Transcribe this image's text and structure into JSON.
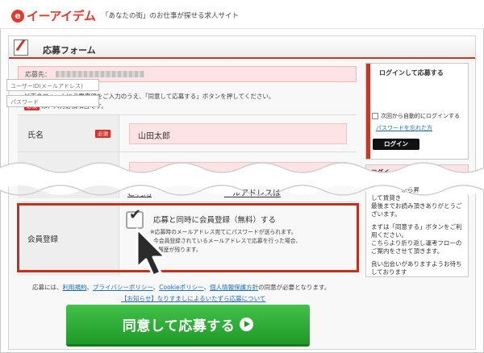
{
  "header": {
    "logo_mark": "e",
    "logo_text": "イーアイデム",
    "tagline": "「あなたの街」のお仕事が探せる求人サイト"
  },
  "form": {
    "title": "応募フォーム",
    "destination_label": "応募先：",
    "instruction_line1": "以下のフォームに必要事項をご入力のうえ、「同意して応募する」ボタンを押してください。",
    "required_badge": "必須",
    "instruction_line2": "は、入力必須項目です。",
    "name_label": "氏名",
    "name_value": "山田太郎",
    "terms_partial": "ご利用",
    "terms_partial_right": "ールアドレスは",
    "member_label": "会員登録",
    "register_label": "応募と同時に会員登録（無料）する",
    "register_checked": true,
    "register_note1": "※応募時のメールアドレス宛てにパスワードが送られます。",
    "register_note2": "今会員登録されているメールアドレスで応募を行った場合、",
    "register_note3": "履歴が残ります。"
  },
  "agreement": {
    "prefix": "応募には、",
    "terms": "利用規約",
    "privacy": "プライバシーポリシー",
    "cookie": "Cookieポリシー",
    "personal": "個人情報保護方針",
    "suffix": "の同意が必要となります。",
    "notice": "【お知らせ】なりすましによるいたずら応募について"
  },
  "cta": {
    "label": "同意して応募する"
  },
  "sidebar": {
    "login_title": "ログインして応募する",
    "user_id_placeholder": "ユーザーID(メールアドレス)",
    "password_placeholder": "パスワード",
    "auto_login": "次回から自動的にログインする",
    "forgot_password": "パスワードを忘れた方",
    "login_button": "ログイン",
    "info_title_partial": "ログイ",
    "info_line1": "人募集の中から昇",
    "info_line2": "して賃貸き",
    "info_line3": "最後までお読み頂きありがとうご",
    "info_line4": "ざいます。",
    "info_line5": "まずは「同意する」ボタンをご利",
    "info_line6": "用ください。",
    "info_line7": "こちらより折り返し運考フローの",
    "info_line8": "ご案内をさせて頂きます。",
    "info_line9": "良い出会いがありますようお待ち",
    "info_line10": "しております"
  },
  "colors": {
    "brand_red": "#e8372b",
    "highlight_red": "#c3301d",
    "cta_green": "#1f9a28",
    "field_pink": "#fde3e3",
    "link_blue": "#1b6ec2"
  }
}
